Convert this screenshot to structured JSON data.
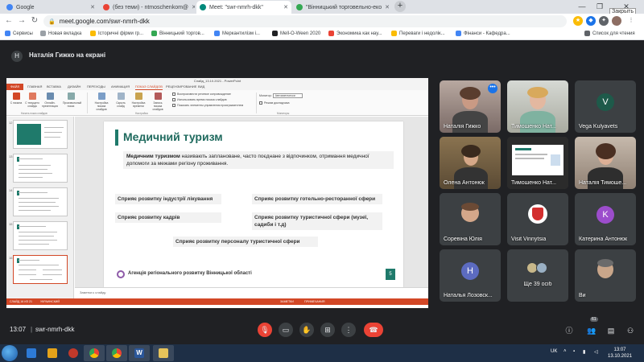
{
  "browser": {
    "tabs": [
      {
        "label": "Google",
        "color": "#4285f4"
      },
      {
        "label": "(без теми) - ntmoschenkom@",
        "color": "#ea4335"
      },
      {
        "label": "Meet: \"swr-nmrh-dkk\"",
        "color": "#00897b",
        "active": true
      },
      {
        "label": "\"Вінницький торговельно-еко",
        "color": "#34a853"
      }
    ],
    "new_tab_label": "+",
    "close_tooltip": "Закрыть",
    "url": "meet.google.com/swr-nmrh-dkk",
    "bookmarks": [
      {
        "label": "Сервисы",
        "color": "#4285f4"
      },
      {
        "label": "Новая вкладка",
        "color": "#9aa0a6"
      },
      {
        "label": "Історичні фірми гр...",
        "color": "#fbbc05"
      },
      {
        "label": "Вінницький торгов...",
        "color": "#34a853"
      },
      {
        "label": "Меркантилізм і...",
        "color": "#4285f4"
      },
      {
        "label": "Mell-O-Ween 2020",
        "color": "#202124"
      },
      {
        "label": "Экономика как нау...",
        "color": "#ea4335"
      },
      {
        "label": "Переваги і недолік...",
        "color": "#fbbc05"
      },
      {
        "label": "Фінанси - Кафедра...",
        "color": "#4285f4"
      }
    ],
    "reading_list": "Список для чтения"
  },
  "meet": {
    "presenter_initial": "H",
    "presenter_text": "Наталія Гижко на екрані",
    "time": "13:07",
    "meeting_code": "swr-nmrh-dkk",
    "people_count": "61",
    "participants": [
      {
        "name": "Наталія Гижко",
        "type": "photo"
      },
      {
        "name": "Тимошенко Нат...",
        "type": "photo"
      },
      {
        "name": "Vega Kulyavets",
        "type": "avatar",
        "initial": "V",
        "color": "#1e5a4a"
      },
      {
        "name": "Олена Антонюк",
        "type": "photo"
      },
      {
        "name": "Тимошенко Нат...",
        "type": "screen"
      },
      {
        "name": "Наталія Тимоше...",
        "type": "photo"
      },
      {
        "name": "Соревіна Юлія",
        "type": "photo"
      },
      {
        "name": "Visit Vinnytsia",
        "type": "logo"
      },
      {
        "name": "Катерина Антонюк",
        "type": "avatar",
        "initial": "K",
        "color": "#9c4dcc"
      },
      {
        "name": "Наталья Лозовск...",
        "type": "avatar",
        "initial": "H",
        "color": "#5c6bc0"
      },
      {
        "name": "Ще 39 осіб",
        "type": "more"
      },
      {
        "name": "Ви",
        "type": "photo"
      }
    ]
  },
  "ppt": {
    "window_title": "Слайд_13.10.2021 - PowerPoint",
    "tabs": [
      "ФАЙЛ",
      "ГЛАВНАЯ",
      "ВСТАВКА",
      "ДИЗАЙН",
      "ПЕРЕХОДЫ",
      "АНИМАЦИЯ",
      "ПОКАЗ СЛАЙДОВ",
      "РЕЦЕНЗИРОВАНИЕ",
      "ВИД"
    ],
    "ribbon_buttons": [
      "С начала",
      "С текущего слайда",
      "Онлайн-презентация",
      "Произвольный показ",
      "Настройка показа слайдов",
      "Скрыть слайд",
      "Настройка времени",
      "Запись показа слайдов"
    ],
    "ribbon_checks": [
      "Воспроизвести речевое сопровождение",
      "Использовать время показа слайдов",
      "Показать элементы управления проигрывателем"
    ],
    "monitor_label": "Монитор:",
    "monitor_value": "Автоматически",
    "presenter_view": "Режим докладчика",
    "groups": [
      "Начать показ слайдов",
      "Настройка",
      "Мониторы"
    ],
    "notes_placeholder": "Заметки к слайду",
    "status_slide": "СЛАЙД 16 ИЗ 21",
    "status_lang": "УКРАИНСКИЙ",
    "status_notes": "ЗАМЕТКИ",
    "status_comments": "ПРИМЕЧАНИЯ",
    "slide": {
      "title": "Медичний туризм",
      "intro_bold": "Медичним туризмом",
      "intro_rest": " називають заплановане, часто поєднане з відпочинком, отримання медичної допомоги за межами регіону проживання.",
      "boxes": [
        "Сприяє розвитку індустрії лікування",
        "Сприяє розвитку готельно-ресторанної сфери",
        "Сприяє розвитку кадрів",
        "Сприяє розвитку туристичної сфери (музеї, садиби і т.д)",
        "Сприяє розвитку персоналу туристичної сфери"
      ],
      "footer": "Агенція регіонального розвитку Вінницької області",
      "number": "5"
    },
    "thumb_numbers": [
      "12",
      "13",
      "14",
      "15",
      "16"
    ]
  },
  "taskbar": {
    "lang": "UK",
    "time": "13:07",
    "date": "13.10.2021",
    "word_glyph": "W"
  }
}
